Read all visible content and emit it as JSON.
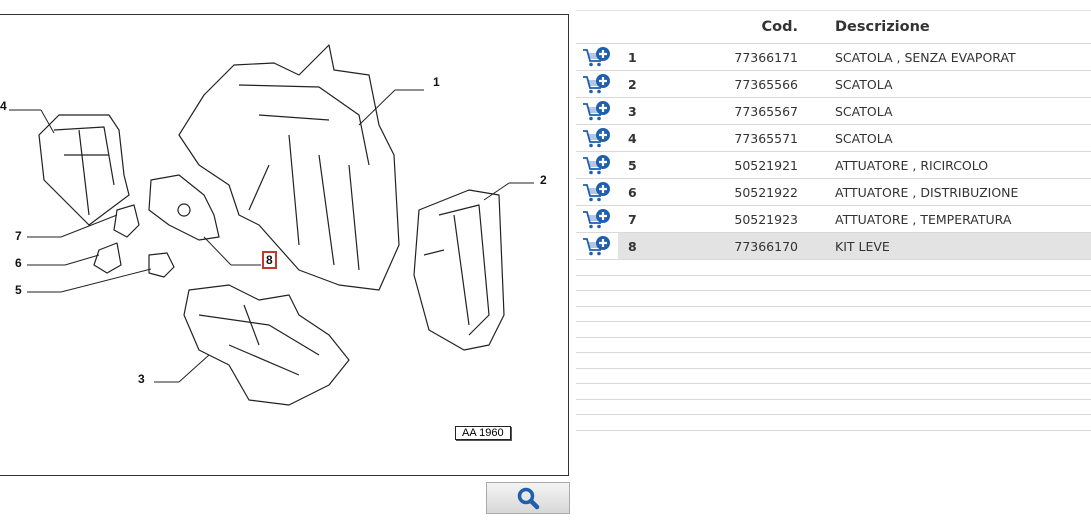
{
  "diagram": {
    "callouts": [
      "1",
      "2",
      "3",
      "4",
      "5",
      "6",
      "7",
      "8"
    ],
    "highlighted": "8",
    "reference": "AA 1960"
  },
  "zoom_button": {
    "icon": "magnifier-icon"
  },
  "table": {
    "headers": {
      "blank1": "",
      "blank2": "",
      "cod": "Cod.",
      "desc": "Descrizione"
    },
    "rows": [
      {
        "num": "1",
        "cod": "77366171",
        "desc": "SCATOLA , SENZA EVAPORAT"
      },
      {
        "num": "2",
        "cod": "77365566",
        "desc": "SCATOLA"
      },
      {
        "num": "3",
        "cod": "77365567",
        "desc": "SCATOLA"
      },
      {
        "num": "4",
        "cod": "77365571",
        "desc": "SCATOLA"
      },
      {
        "num": "5",
        "cod": "50521921",
        "desc": "ATTUATORE , RICIRCOLO"
      },
      {
        "num": "6",
        "cod": "50521922",
        "desc": "ATTUATORE , DISTRIBUZIONE"
      },
      {
        "num": "7",
        "cod": "50521923",
        "desc": "ATTUATORE , TEMPERATURA"
      },
      {
        "num": "8",
        "cod": "77366170",
        "desc": "KIT LEVE"
      }
    ],
    "selected_row": "8",
    "row_icon": "add-to-cart-icon",
    "colors": {
      "icon_blue": "#1f5fae",
      "selected_bg": "#e3e3e3",
      "border": "#d9d9d9"
    }
  }
}
